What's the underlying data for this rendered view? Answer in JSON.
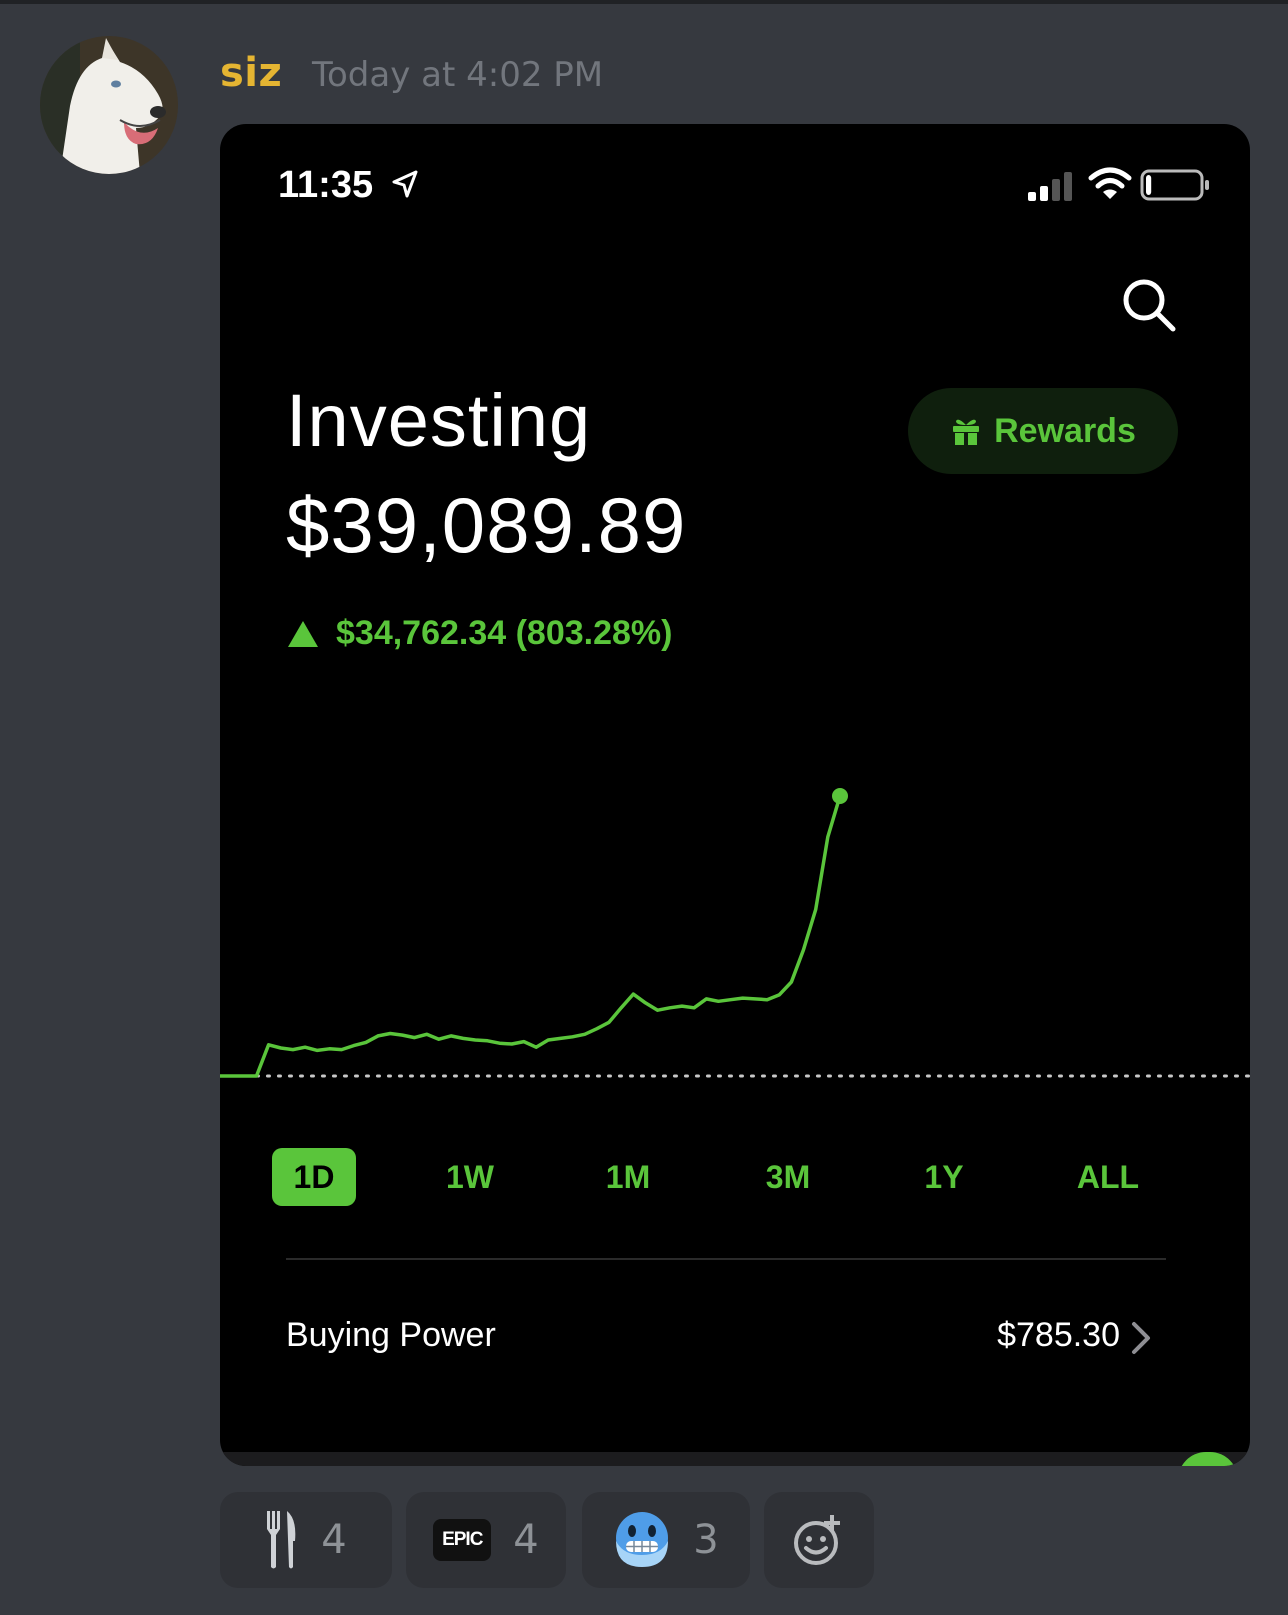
{
  "message": {
    "username": "siz",
    "timestamp": "Today at 4:02 PM",
    "username_color": "#e5b532"
  },
  "phone": {
    "status_bar": {
      "time": "11:35",
      "icons": [
        "location-arrow-icon",
        "signal-icon",
        "wifi-icon",
        "battery-icon"
      ],
      "battery_level": 0.1
    },
    "header": {
      "title": "Investing",
      "balance": "$39,089.89",
      "rewards_label": "Rewards",
      "change_text": "$34,762.34 (803.28%)"
    },
    "ranges": [
      "1D",
      "1W",
      "1M",
      "3M",
      "1Y",
      "ALL"
    ],
    "active_range": "1D",
    "buying_power": {
      "label": "Buying Power",
      "value": "$785.30"
    },
    "accent_color": "#5ac53b"
  },
  "chart_data": {
    "type": "line",
    "series": [
      {
        "values": [
          4327,
          4327,
          4327,
          4327,
          8200,
          7800,
          7600,
          7900,
          7500,
          7700,
          7600,
          8100,
          8500,
          9300,
          9600,
          9400,
          9100,
          9500,
          8900,
          9300,
          9000,
          8800,
          8700,
          8400,
          8300,
          8600,
          7900,
          8800,
          9000,
          9200,
          9500,
          10200,
          11000,
          12800,
          14500,
          13400,
          12500,
          12800,
          13000,
          12800,
          13900,
          13600,
          13800,
          14000,
          13900,
          13800,
          14400,
          16000,
          20000,
          25000,
          34000,
          39089
        ]
      }
    ],
    "baseline": 4327.55,
    "baseline_style": "dotted",
    "end_marker": true,
    "grid": false
  },
  "reactions": [
    {
      "icon": "fork-knife-icon",
      "count": "4"
    },
    {
      "icon": "epic-badge-icon",
      "label": "EPIC",
      "count": "4"
    },
    {
      "icon": "cold-face-icon",
      "count": "3"
    }
  ],
  "add_reaction_icon": "add-reaction-icon"
}
